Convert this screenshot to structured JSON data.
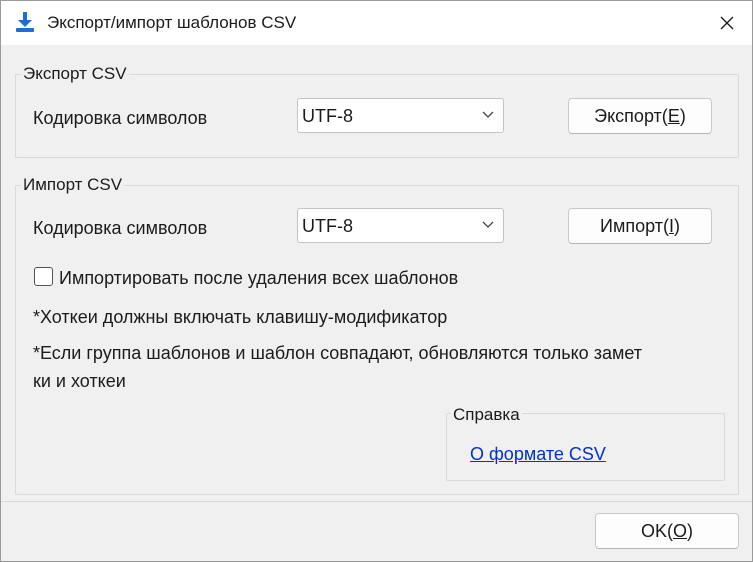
{
  "window": {
    "title": "Экспорт/импорт шаблонов CSV"
  },
  "export": {
    "group_label": "Экспорт CSV",
    "encoding_label": "Кодировка символов",
    "encoding_value": "UTF-8",
    "button_text": "Экспорт(",
    "button_mnemonic": "E",
    "button_suffix": ")"
  },
  "import": {
    "group_label": "Импорт CSV",
    "encoding_label": "Кодировка символов",
    "encoding_value": "UTF-8",
    "button_text": "Импорт(",
    "button_mnemonic": "I",
    "button_suffix": ")",
    "checkbox_label": "Импортировать после удаления всех шаблонов",
    "checkbox_checked": false,
    "note1": "*Хоткеи должны включать клавишу-модификатор",
    "note2_line1": "*Если группа шаблонов и шаблон совпадают, обновляются только замет",
    "note2_line2": "ки и хоткеи"
  },
  "help": {
    "group_label": "Справка",
    "link_text": "О формате CSV"
  },
  "footer": {
    "ok_text": "OK(",
    "ok_mnemonic": "O",
    "ok_suffix": ")"
  },
  "colors": {
    "link": "#0033cc",
    "icon_blue": "#1f6fd0"
  }
}
